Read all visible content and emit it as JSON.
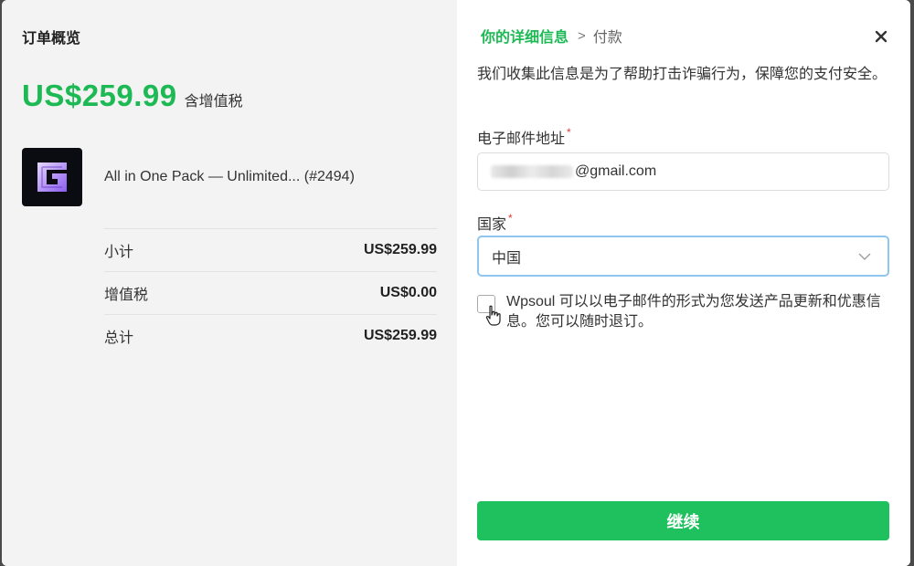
{
  "summary": {
    "title": "订单概览",
    "price": "US$259.99",
    "price_note": "含增值税",
    "product": {
      "name": "All in One Pack — Unlimited... (#2494)",
      "icon": "g-logo-icon"
    },
    "rows": [
      {
        "label": "小计",
        "value": "US$259.99"
      },
      {
        "label": "增值税",
        "value": "US$0.00"
      },
      {
        "label": "总计",
        "value": "US$259.99"
      }
    ]
  },
  "form": {
    "breadcrumb": {
      "current": "你的详细信息",
      "separator": ">",
      "next": "付款"
    },
    "info": "我们收集此信息是为了帮助打击诈骗行为，保障您的支付安全。",
    "email_label": "电子邮件地址",
    "email_value": "@gmail.com",
    "country_label": "国家",
    "country_value": "中国",
    "required_mark": "*",
    "consent_text": "Wpsoul 可以以电子邮件的形式为您发送产品更新和优惠信息。您可以随时退订。",
    "continue_label": "继续"
  },
  "colors": {
    "accent": "#1db954",
    "button": "#1ec15d",
    "required": "#e53935",
    "focus_border": "#8ec6f0"
  }
}
